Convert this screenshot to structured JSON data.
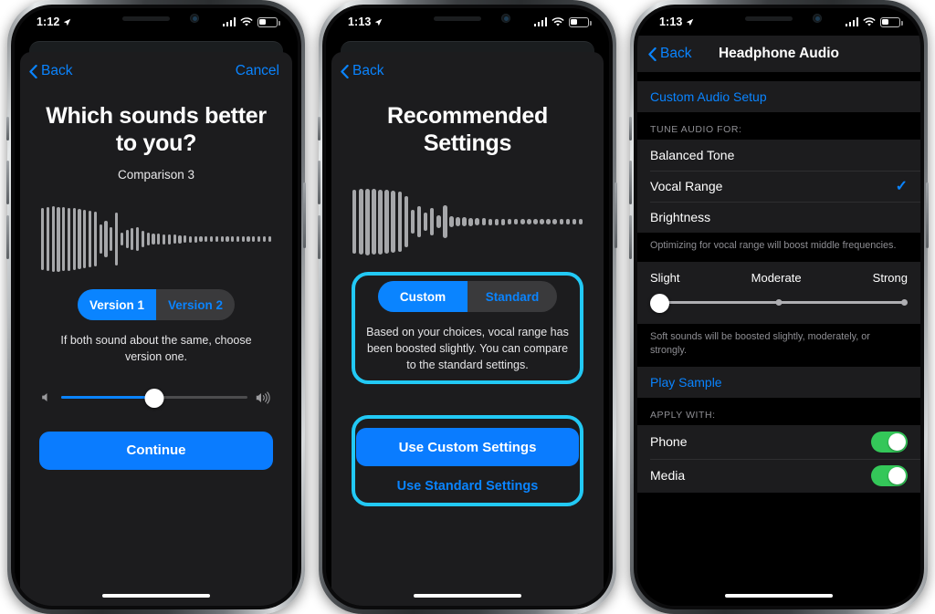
{
  "phones": [
    {
      "id": "comparison",
      "status": {
        "time": "1:12",
        "location_icon": "location-arrow-icon",
        "signal_icon": "cellular-signal-icon",
        "wifi_icon": "wifi-icon",
        "battery_icon": "battery-icon"
      },
      "nav": {
        "back": "Back",
        "cancel": "Cancel"
      },
      "title": "Which sounds better to you?",
      "subtitle": "Comparison 3",
      "segmented": {
        "options": [
          "Version 1",
          "Version 2"
        ],
        "selected": "Version 1"
      },
      "helper": "If both sound about the same, choose version one.",
      "volume": {
        "min_icon": "speaker-low-icon",
        "max_icon": "speaker-high-icon",
        "value": 50
      },
      "primary_button": "Continue"
    },
    {
      "id": "recommended",
      "status": {
        "time": "1:13",
        "location_icon": "location-arrow-icon",
        "signal_icon": "cellular-signal-icon",
        "wifi_icon": "wifi-icon",
        "battery_icon": "battery-icon"
      },
      "nav": {
        "back": "Back"
      },
      "title": "Recommended Settings",
      "segmented": {
        "options": [
          "Custom",
          "Standard"
        ],
        "selected": "Custom"
      },
      "helper": "Based on your choices, vocal range has been boosted slightly. You can compare to the standard settings.",
      "primary_button": "Use Custom Settings",
      "secondary_button": "Use Standard Settings",
      "highlight_color": "#22c9f5"
    },
    {
      "id": "headphone-audio",
      "status": {
        "time": "1:13",
        "location_icon": "location-arrow-icon",
        "signal_icon": "cellular-signal-icon",
        "wifi_icon": "wifi-icon",
        "battery_icon": "battery-icon"
      },
      "nav": {
        "back": "Back",
        "title": "Headphone Audio"
      },
      "custom_setup_link": "Custom Audio Setup",
      "tune_header": "TUNE AUDIO FOR:",
      "tune_options": [
        {
          "label": "Balanced Tone",
          "selected": false
        },
        {
          "label": "Vocal Range",
          "selected": true
        },
        {
          "label": "Brightness",
          "selected": false
        }
      ],
      "tune_footnote": "Optimizing for vocal range will boost middle frequencies.",
      "strength": {
        "labels": [
          "Slight",
          "Moderate",
          "Strong"
        ],
        "value": "Slight"
      },
      "strength_footnote": "Soft sounds will be boosted slightly, moderately, or strongly.",
      "play_sample": "Play Sample",
      "apply_header": "APPLY WITH:",
      "apply_rows": [
        {
          "label": "Phone",
          "on": true
        },
        {
          "label": "Media",
          "on": true
        }
      ]
    }
  ],
  "theme": {
    "accent_blue": "#0a84ff",
    "highlight_cyan": "#22c9f5",
    "toggle_green": "#34c759",
    "screen_bg": "#000000",
    "sheet_bg": "#1c1c1e",
    "waveform_gray": "#a6a7aa"
  },
  "waveforms": {
    "comparison": [
      68,
      70,
      72,
      71,
      70,
      69,
      68,
      66,
      64,
      62,
      60,
      32,
      40,
      26,
      58,
      14,
      20,
      24,
      26,
      18,
      14,
      12,
      12,
      11,
      11,
      10,
      9,
      8,
      7,
      7,
      6,
      6,
      6,
      6,
      6,
      6,
      6,
      6,
      6,
      6,
      6,
      6,
      6,
      6
    ],
    "recommended": [
      70,
      72,
      73,
      72,
      71,
      70,
      68,
      66,
      56,
      26,
      34,
      20,
      30,
      14,
      36,
      12,
      10,
      10,
      9,
      8,
      8,
      7,
      7,
      7,
      6,
      6,
      6,
      6,
      6,
      6,
      6,
      6,
      6,
      6,
      6,
      6
    ]
  }
}
